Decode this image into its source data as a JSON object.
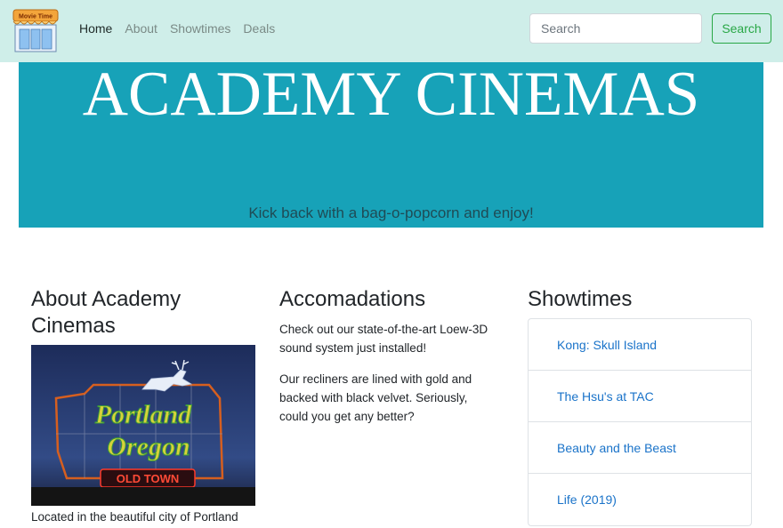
{
  "navbar": {
    "logo_text": "Movie Time",
    "links": [
      {
        "label": "Home",
        "active": true
      },
      {
        "label": "About",
        "active": false
      },
      {
        "label": "Showtimes",
        "active": false
      },
      {
        "label": "Deals",
        "active": false
      }
    ],
    "search": {
      "placeholder": "Search",
      "value": ""
    },
    "search_button": "Search"
  },
  "hero": {
    "title": "ACADEMY CINEMAS",
    "tagline": "Kick back with a bag-o-popcorn and enjoy!"
  },
  "about": {
    "heading": "About Academy Cinemas",
    "photo_sign_text": "Portland Oregon",
    "photo_sub_text": "OLD TOWN",
    "caption": "Located in the beautiful city of Portland"
  },
  "accommodations": {
    "heading": "Accomadations",
    "paragraphs": [
      "Check out our state-of-the-art Loew-3D sound system just installed!",
      "Our recliners are lined with gold and backed with black velvet. Seriously, could you get any better?"
    ]
  },
  "showtimes": {
    "heading": "Showtimes",
    "items": [
      "Kong: Skull Island",
      "The Hsu's at TAC",
      "Beauty and the Beast",
      "Life (2019)"
    ]
  },
  "colors": {
    "navbar_bg": "#cfeee9",
    "hero_bg": "#17a2b8",
    "link_blue": "#1a73c9",
    "success_green": "#28a745"
  }
}
